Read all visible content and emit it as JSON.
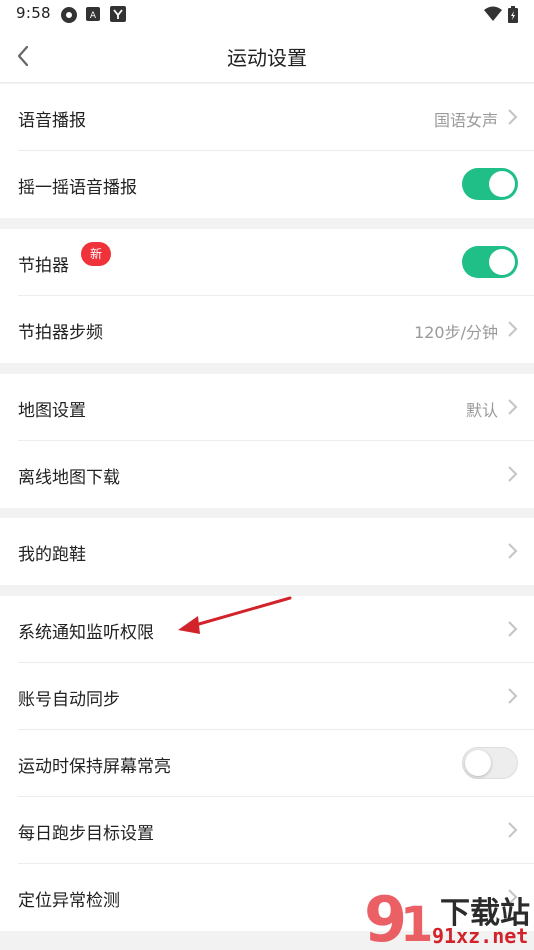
{
  "status": {
    "time": "9:58"
  },
  "header": {
    "title": "运动设置",
    "back_icon": "chevron-left-icon"
  },
  "colors": {
    "accent": "#1fbf87",
    "badge": "#f0333b",
    "arrow": "#d2232a"
  },
  "groups": [
    {
      "rows": [
        {
          "label": "语音播报",
          "value": "国语女声",
          "control": "chevron"
        },
        {
          "label": "摇一摇语音播报",
          "control": "toggle",
          "on": true
        }
      ]
    },
    {
      "rows": [
        {
          "label": "节拍器",
          "badge": "新",
          "control": "toggle",
          "on": true
        },
        {
          "label": "节拍器步频",
          "value": "120步/分钟",
          "control": "chevron"
        }
      ]
    },
    {
      "rows": [
        {
          "label": "地图设置",
          "value": "默认",
          "control": "chevron"
        },
        {
          "label": "离线地图下载",
          "control": "chevron"
        }
      ]
    },
    {
      "rows": [
        {
          "label": "我的跑鞋",
          "control": "chevron"
        }
      ]
    },
    {
      "rows": [
        {
          "label": "系统通知监听权限",
          "control": "chevron"
        },
        {
          "label": "账号自动同步",
          "control": "chevron"
        },
        {
          "label": "运动时保持屏幕常亮",
          "control": "toggle",
          "on": false
        },
        {
          "label": "每日跑步目标设置",
          "control": "chevron"
        },
        {
          "label": "定位异常检测",
          "control": "chevron"
        }
      ]
    }
  ],
  "watermark": {
    "top": "下载站",
    "bottom": "91xz.net"
  }
}
